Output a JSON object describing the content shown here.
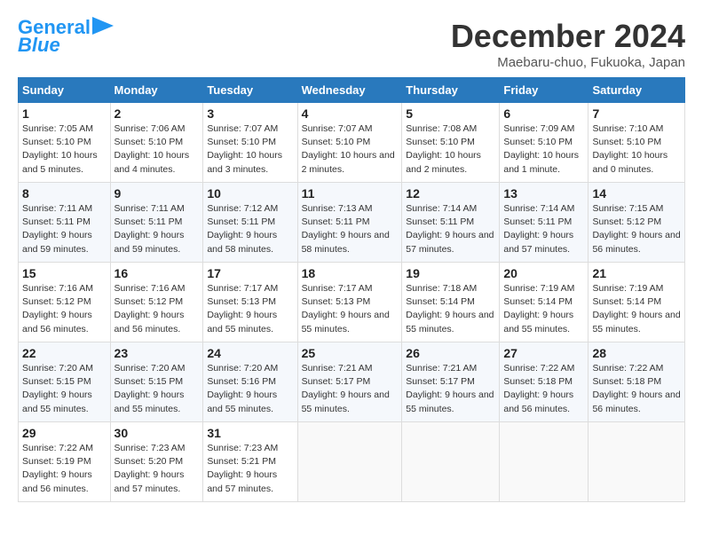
{
  "logo": {
    "line1": "General",
    "line2": "Blue"
  },
  "title": "December 2024",
  "location": "Maebaru-chuo, Fukuoka, Japan",
  "weekdays": [
    "Sunday",
    "Monday",
    "Tuesday",
    "Wednesday",
    "Thursday",
    "Friday",
    "Saturday"
  ],
  "weeks": [
    [
      {
        "day": "1",
        "sunrise": "7:05 AM",
        "sunset": "5:10 PM",
        "daylight": "10 hours and 5 minutes."
      },
      {
        "day": "2",
        "sunrise": "7:06 AM",
        "sunset": "5:10 PM",
        "daylight": "10 hours and 4 minutes."
      },
      {
        "day": "3",
        "sunrise": "7:07 AM",
        "sunset": "5:10 PM",
        "daylight": "10 hours and 3 minutes."
      },
      {
        "day": "4",
        "sunrise": "7:07 AM",
        "sunset": "5:10 PM",
        "daylight": "10 hours and 2 minutes."
      },
      {
        "day": "5",
        "sunrise": "7:08 AM",
        "sunset": "5:10 PM",
        "daylight": "10 hours and 2 minutes."
      },
      {
        "day": "6",
        "sunrise": "7:09 AM",
        "sunset": "5:10 PM",
        "daylight": "10 hours and 1 minute."
      },
      {
        "day": "7",
        "sunrise": "7:10 AM",
        "sunset": "5:10 PM",
        "daylight": "10 hours and 0 minutes."
      }
    ],
    [
      {
        "day": "8",
        "sunrise": "7:11 AM",
        "sunset": "5:11 PM",
        "daylight": "9 hours and 59 minutes."
      },
      {
        "day": "9",
        "sunrise": "7:11 AM",
        "sunset": "5:11 PM",
        "daylight": "9 hours and 59 minutes."
      },
      {
        "day": "10",
        "sunrise": "7:12 AM",
        "sunset": "5:11 PM",
        "daylight": "9 hours and 58 minutes."
      },
      {
        "day": "11",
        "sunrise": "7:13 AM",
        "sunset": "5:11 PM",
        "daylight": "9 hours and 58 minutes."
      },
      {
        "day": "12",
        "sunrise": "7:14 AM",
        "sunset": "5:11 PM",
        "daylight": "9 hours and 57 minutes."
      },
      {
        "day": "13",
        "sunrise": "7:14 AM",
        "sunset": "5:11 PM",
        "daylight": "9 hours and 57 minutes."
      },
      {
        "day": "14",
        "sunrise": "7:15 AM",
        "sunset": "5:12 PM",
        "daylight": "9 hours and 56 minutes."
      }
    ],
    [
      {
        "day": "15",
        "sunrise": "7:16 AM",
        "sunset": "5:12 PM",
        "daylight": "9 hours and 56 minutes."
      },
      {
        "day": "16",
        "sunrise": "7:16 AM",
        "sunset": "5:12 PM",
        "daylight": "9 hours and 56 minutes."
      },
      {
        "day": "17",
        "sunrise": "7:17 AM",
        "sunset": "5:13 PM",
        "daylight": "9 hours and 55 minutes."
      },
      {
        "day": "18",
        "sunrise": "7:17 AM",
        "sunset": "5:13 PM",
        "daylight": "9 hours and 55 minutes."
      },
      {
        "day": "19",
        "sunrise": "7:18 AM",
        "sunset": "5:14 PM",
        "daylight": "9 hours and 55 minutes."
      },
      {
        "day": "20",
        "sunrise": "7:19 AM",
        "sunset": "5:14 PM",
        "daylight": "9 hours and 55 minutes."
      },
      {
        "day": "21",
        "sunrise": "7:19 AM",
        "sunset": "5:14 PM",
        "daylight": "9 hours and 55 minutes."
      }
    ],
    [
      {
        "day": "22",
        "sunrise": "7:20 AM",
        "sunset": "5:15 PM",
        "daylight": "9 hours and 55 minutes."
      },
      {
        "day": "23",
        "sunrise": "7:20 AM",
        "sunset": "5:15 PM",
        "daylight": "9 hours and 55 minutes."
      },
      {
        "day": "24",
        "sunrise": "7:20 AM",
        "sunset": "5:16 PM",
        "daylight": "9 hours and 55 minutes."
      },
      {
        "day": "25",
        "sunrise": "7:21 AM",
        "sunset": "5:17 PM",
        "daylight": "9 hours and 55 minutes."
      },
      {
        "day": "26",
        "sunrise": "7:21 AM",
        "sunset": "5:17 PM",
        "daylight": "9 hours and 55 minutes."
      },
      {
        "day": "27",
        "sunrise": "7:22 AM",
        "sunset": "5:18 PM",
        "daylight": "9 hours and 56 minutes."
      },
      {
        "day": "28",
        "sunrise": "7:22 AM",
        "sunset": "5:18 PM",
        "daylight": "9 hours and 56 minutes."
      }
    ],
    [
      {
        "day": "29",
        "sunrise": "7:22 AM",
        "sunset": "5:19 PM",
        "daylight": "9 hours and 56 minutes."
      },
      {
        "day": "30",
        "sunrise": "7:23 AM",
        "sunset": "5:20 PM",
        "daylight": "9 hours and 57 minutes."
      },
      {
        "day": "31",
        "sunrise": "7:23 AM",
        "sunset": "5:21 PM",
        "daylight": "9 hours and 57 minutes."
      },
      null,
      null,
      null,
      null
    ]
  ]
}
